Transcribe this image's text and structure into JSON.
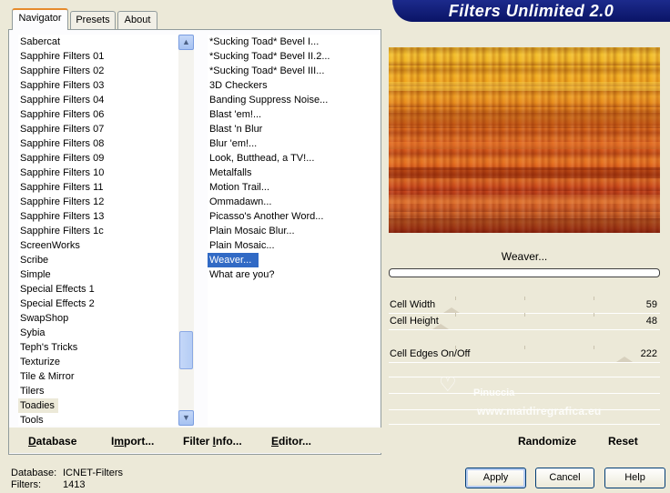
{
  "tabs": [
    {
      "label": "Navigator"
    },
    {
      "label": "Presets"
    },
    {
      "label": "About"
    }
  ],
  "app": {
    "title": "Filters Unlimited 2.0"
  },
  "categories": [
    {
      "label": "Sabercat"
    },
    {
      "label": "Sapphire Filters 01"
    },
    {
      "label": "Sapphire Filters 02"
    },
    {
      "label": "Sapphire Filters 03"
    },
    {
      "label": "Sapphire Filters 04"
    },
    {
      "label": "Sapphire Filters 06"
    },
    {
      "label": "Sapphire Filters 07"
    },
    {
      "label": "Sapphire Filters 08"
    },
    {
      "label": "Sapphire Filters 09"
    },
    {
      "label": "Sapphire Filters 10"
    },
    {
      "label": "Sapphire Filters 11"
    },
    {
      "label": "Sapphire Filters 12"
    },
    {
      "label": "Sapphire Filters 13"
    },
    {
      "label": "Sapphire Filters 1c"
    },
    {
      "label": "ScreenWorks"
    },
    {
      "label": "Scribe"
    },
    {
      "label": "Simple"
    },
    {
      "label": "Special Effects 1"
    },
    {
      "label": "Special Effects 2"
    },
    {
      "label": "SwapShop"
    },
    {
      "label": "Sybia"
    },
    {
      "label": "Teph's Tricks"
    },
    {
      "label": "Texturize"
    },
    {
      "label": "Tile & Mirror"
    },
    {
      "label": "Tilers"
    },
    {
      "label": "Toadies"
    },
    {
      "label": "Tools"
    }
  ],
  "filters": [
    {
      "label": "*Sucking Toad*  Bevel I..."
    },
    {
      "label": "*Sucking Toad*  Bevel II.2..."
    },
    {
      "label": "*Sucking Toad*  Bevel III..."
    },
    {
      "label": "3D Checkers"
    },
    {
      "label": "Banding Suppress Noise..."
    },
    {
      "label": "Blast 'em!..."
    },
    {
      "label": "Blast 'n Blur"
    },
    {
      "label": "Blur 'em!..."
    },
    {
      "label": "Look, Butthead, a TV!..."
    },
    {
      "label": "Metalfalls"
    },
    {
      "label": "Motion Trail..."
    },
    {
      "label": "Ommadawn..."
    },
    {
      "label": "Picasso's Another Word..."
    },
    {
      "label": "Plain Mosaic Blur..."
    },
    {
      "label": "Plain Mosaic..."
    },
    {
      "label": "Weaver..."
    },
    {
      "label": "What are you?"
    }
  ],
  "left_buttons": {
    "database": {
      "underline": "D",
      "rest": "atabase"
    },
    "import": {
      "pre": "I",
      "underline": "m",
      "rest": "port..."
    },
    "filter_info": {
      "pre": "Filter ",
      "underline": "I",
      "rest": "nfo..."
    },
    "editor": {
      "underline": "E",
      "rest": "ditor..."
    }
  },
  "right_buttons": {
    "randomize": "Randomize",
    "reset": "Reset"
  },
  "preview": {
    "filter_name": "Weaver...",
    "progress": 0
  },
  "params": [
    {
      "label": "Cell Width",
      "value": "59",
      "level": 0.23
    },
    {
      "label": "Cell Height",
      "value": "48",
      "level": 0.19
    },
    {
      "label": "Cell Edges On/Off",
      "value": "222",
      "level": 0.87
    }
  ],
  "footer": {
    "database_label": "Database:",
    "database_value": "ICNET-Filters",
    "filters_label": "Filters:",
    "filters_value": "1413"
  },
  "dialog_buttons": {
    "apply": "Apply",
    "cancel": "Cancel",
    "help": "Help"
  },
  "watermark": {
    "line1": "Pinuccia",
    "line2": "www.maidiregrafica.eu"
  },
  "colors": {
    "banner": "#0a1466",
    "selection": "#316ac5",
    "category_highlight": "#ece9d8",
    "tab_accent": "#e68b2c"
  }
}
